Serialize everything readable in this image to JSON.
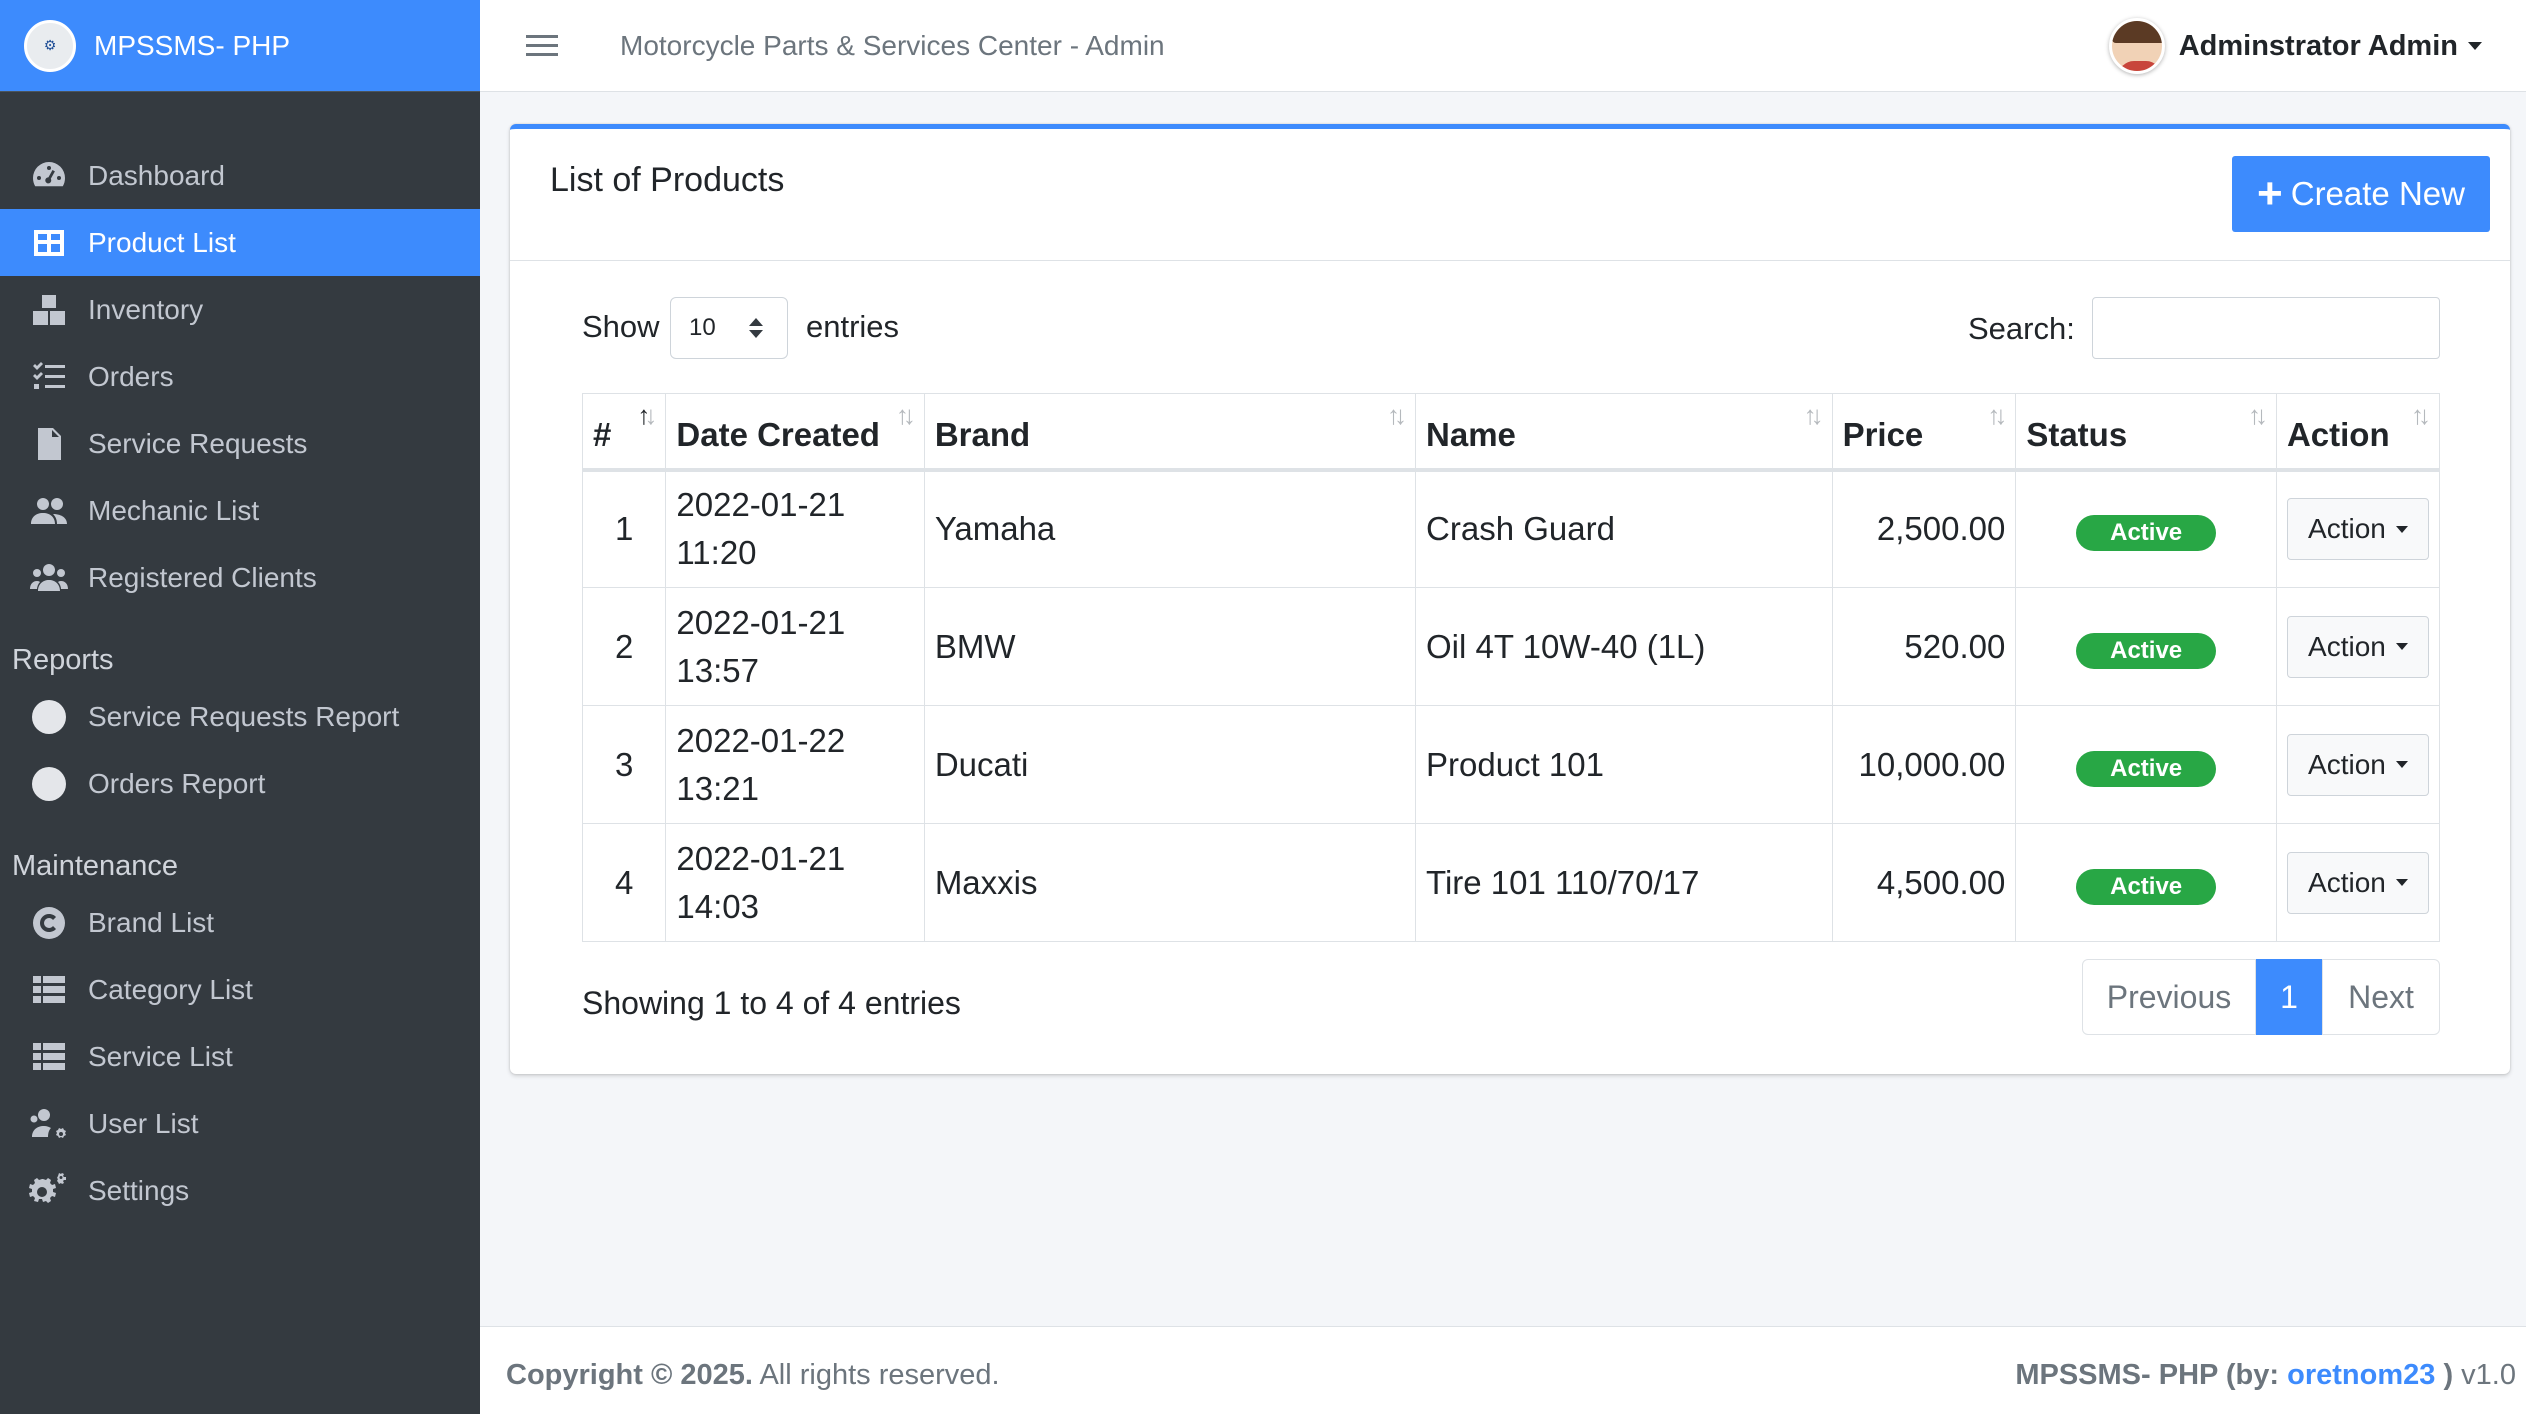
{
  "brand": {
    "name": "MPSSMS- PHP"
  },
  "header": {
    "title": "Motorcycle Parts & Services Center - Admin",
    "user_name": "Adminstrator Admin"
  },
  "sidebar": {
    "items": [
      {
        "label": "Dashboard",
        "icon": "dashboard-icon"
      },
      {
        "label": "Product List",
        "icon": "table-icon",
        "active": true
      },
      {
        "label": "Inventory",
        "icon": "boxes-icon"
      },
      {
        "label": "Orders",
        "icon": "list-check-icon"
      },
      {
        "label": "Service Requests",
        "icon": "file-icon"
      },
      {
        "label": "Mechanic List",
        "icon": "users-icon"
      },
      {
        "label": "Registered Clients",
        "icon": "users-group-icon"
      }
    ],
    "reports_header": "Reports",
    "reports": [
      {
        "label": "Service Requests Report",
        "icon": "circle-icon"
      },
      {
        "label": "Orders Report",
        "icon": "circle-icon"
      }
    ],
    "maintenance_header": "Maintenance",
    "maintenance": [
      {
        "label": "Brand List",
        "icon": "copyright-icon"
      },
      {
        "label": "Category List",
        "icon": "th-list-icon"
      },
      {
        "label": "Service List",
        "icon": "th-list-icon"
      },
      {
        "label": "User List",
        "icon": "users-cog-icon"
      },
      {
        "label": "Settings",
        "icon": "cogs-icon"
      }
    ]
  },
  "card": {
    "title": "List of Products",
    "create_label": "Create New",
    "show_label": "Show",
    "entries_value": "10",
    "entries_label": "entries",
    "search_label": "Search:",
    "search_value": ""
  },
  "table": {
    "columns": [
      "#",
      "Date Created",
      "Brand",
      "Name",
      "Price",
      "Status",
      "Action"
    ],
    "rows": [
      {
        "num": "1",
        "date": "2022-01-21",
        "time": "11:20",
        "brand": "Yamaha",
        "name": "Crash Guard",
        "price": "2,500.00",
        "status": "Active",
        "action": "Action"
      },
      {
        "num": "2",
        "date": "2022-01-21",
        "time": "13:57",
        "brand": "BMW",
        "name": "Oil 4T 10W-40 (1L)",
        "price": "520.00",
        "status": "Active",
        "action": "Action"
      },
      {
        "num": "3",
        "date": "2022-01-22",
        "time": "13:21",
        "brand": "Ducati",
        "name": "Product 101",
        "price": "10,000.00",
        "status": "Active",
        "action": "Action"
      },
      {
        "num": "4",
        "date": "2022-01-21",
        "time": "14:03",
        "brand": "Maxxis",
        "name": "Tire 101 110/70/17",
        "price": "4,500.00",
        "status": "Active",
        "action": "Action"
      }
    ]
  },
  "pagination": {
    "info": "Showing 1 to 4 of 4 entries",
    "previous": "Previous",
    "current": "1",
    "next": "Next"
  },
  "footer": {
    "copyright": "Copyright © 2025.",
    "rights": "All rights reserved.",
    "app": "MPSSMS- PHP (by:",
    "author": "oretnom23",
    "close": ")",
    "version": "v1.0"
  },
  "colors": {
    "primary": "#3d8bfd",
    "sidebar": "#343a40",
    "success": "#28a745"
  }
}
